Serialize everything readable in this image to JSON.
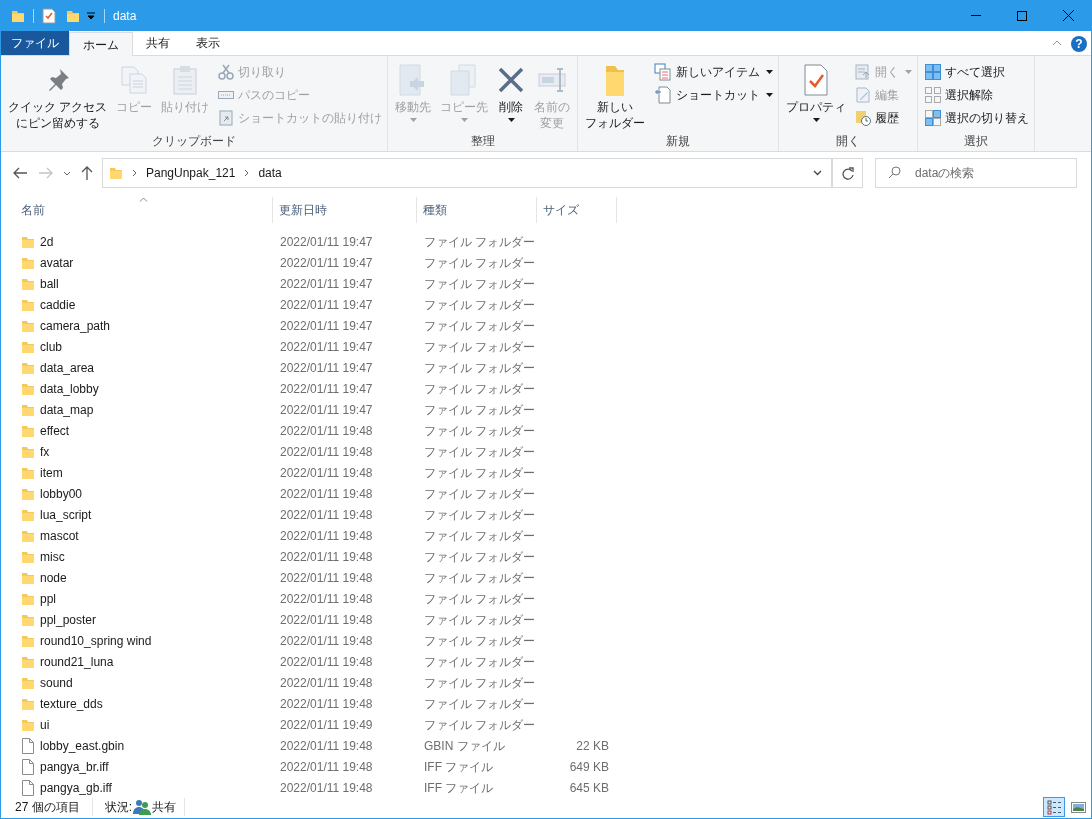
{
  "window": {
    "title": "data"
  },
  "ribbon": {
    "tabs": [
      {
        "label": "ファイル",
        "kind": "file",
        "selected": false
      },
      {
        "label": "ホーム",
        "kind": "tab",
        "selected": true
      },
      {
        "label": "共有",
        "kind": "tab",
        "selected": false
      },
      {
        "label": "表示",
        "kind": "tab",
        "selected": false
      }
    ],
    "groups": [
      {
        "label": "クリップボード",
        "items": [
          {
            "lines": [
              "クイック アクセス",
              "にピン留めする"
            ],
            "kind": "large",
            "disabled": false,
            "dropdown": false
          },
          {
            "label": "コピー",
            "kind": "large",
            "disabled": true,
            "dropdown": false
          },
          {
            "label": "貼り付け",
            "kind": "large",
            "disabled": true,
            "dropdown": false
          },
          {
            "label": "切り取り",
            "kind": "small",
            "disabled": true,
            "dropdown": false
          },
          {
            "label": "パスのコピー",
            "kind": "small",
            "disabled": true,
            "dropdown": false
          },
          {
            "label": "ショートカットの貼り付け",
            "kind": "small",
            "disabled": true,
            "dropdown": false
          }
        ]
      },
      {
        "label": "整理",
        "items": [
          {
            "label": "移動先",
            "kind": "large",
            "disabled": true,
            "dropdown": true
          },
          {
            "label": "コピー先",
            "kind": "large",
            "disabled": true,
            "dropdown": true
          },
          {
            "label": "削除",
            "kind": "large",
            "disabled": false,
            "dropdown": true
          },
          {
            "lines": [
              "名前の",
              "変更"
            ],
            "kind": "large",
            "disabled": true,
            "dropdown": false
          }
        ]
      },
      {
        "label": "新規",
        "items": [
          {
            "lines": [
              "新しい",
              "フォルダー"
            ],
            "kind": "large",
            "disabled": false,
            "dropdown": false
          },
          {
            "label": "新しいアイテム",
            "kind": "small",
            "disabled": false,
            "dropdown": true
          },
          {
            "label": "ショートカット",
            "kind": "small",
            "disabled": false,
            "dropdown": true
          }
        ]
      },
      {
        "label": "開く",
        "items": [
          {
            "label": "プロパティ",
            "kind": "large",
            "disabled": false,
            "dropdown": true
          },
          {
            "label": "開く",
            "kind": "small",
            "disabled": true,
            "dropdown": true
          },
          {
            "label": "編集",
            "kind": "small",
            "disabled": true,
            "dropdown": false
          },
          {
            "label": "履歴",
            "kind": "small",
            "disabled": false,
            "dropdown": false
          }
        ]
      },
      {
        "label": "選択",
        "items": [
          {
            "label": "すべて選択",
            "kind": "small",
            "disabled": false,
            "dropdown": false
          },
          {
            "label": "選択解除",
            "kind": "small",
            "disabled": false,
            "dropdown": false
          },
          {
            "label": "選択の切り替え",
            "kind": "small",
            "disabled": false,
            "dropdown": false
          }
        ]
      }
    ]
  },
  "help_button": {
    "label": "?"
  },
  "address": {
    "path": [
      "PangUnpak_121",
      "data"
    ],
    "search_placeholder": "dataの検索"
  },
  "columns": [
    {
      "label": "名前",
      "sorted": true
    },
    {
      "label": "更新日時",
      "sorted": false
    },
    {
      "label": "種類",
      "sorted": false
    },
    {
      "label": "サイズ",
      "sorted": false
    }
  ],
  "rows": [
    {
      "kind": "folder",
      "name": "2d",
      "modified": "2022/01/11 19:47",
      "type": "ファイル フォルダー"
    },
    {
      "kind": "folder",
      "name": "avatar",
      "modified": "2022/01/11 19:47",
      "type": "ファイル フォルダー"
    },
    {
      "kind": "folder",
      "name": "ball",
      "modified": "2022/01/11 19:47",
      "type": "ファイル フォルダー"
    },
    {
      "kind": "folder",
      "name": "caddie",
      "modified": "2022/01/11 19:47",
      "type": "ファイル フォルダー"
    },
    {
      "kind": "folder",
      "name": "camera_path",
      "modified": "2022/01/11 19:47",
      "type": "ファイル フォルダー"
    },
    {
      "kind": "folder",
      "name": "club",
      "modified": "2022/01/11 19:47",
      "type": "ファイル フォルダー"
    },
    {
      "kind": "folder",
      "name": "data_area",
      "modified": "2022/01/11 19:47",
      "type": "ファイル フォルダー"
    },
    {
      "kind": "folder",
      "name": "data_lobby",
      "modified": "2022/01/11 19:47",
      "type": "ファイル フォルダー"
    },
    {
      "kind": "folder",
      "name": "data_map",
      "modified": "2022/01/11 19:47",
      "type": "ファイル フォルダー"
    },
    {
      "kind": "folder",
      "name": "effect",
      "modified": "2022/01/11 19:48",
      "type": "ファイル フォルダー"
    },
    {
      "kind": "folder",
      "name": "fx",
      "modified": "2022/01/11 19:48",
      "type": "ファイル フォルダー"
    },
    {
      "kind": "folder",
      "name": "item",
      "modified": "2022/01/11 19:48",
      "type": "ファイル フォルダー"
    },
    {
      "kind": "folder",
      "name": "lobby00",
      "modified": "2022/01/11 19:48",
      "type": "ファイル フォルダー"
    },
    {
      "kind": "folder",
      "name": "lua_script",
      "modified": "2022/01/11 19:48",
      "type": "ファイル フォルダー"
    },
    {
      "kind": "folder",
      "name": "mascot",
      "modified": "2022/01/11 19:48",
      "type": "ファイル フォルダー"
    },
    {
      "kind": "folder",
      "name": "misc",
      "modified": "2022/01/11 19:48",
      "type": "ファイル フォルダー"
    },
    {
      "kind": "folder",
      "name": "node",
      "modified": "2022/01/11 19:48",
      "type": "ファイル フォルダー"
    },
    {
      "kind": "folder",
      "name": "ppl",
      "modified": "2022/01/11 19:48",
      "type": "ファイル フォルダー"
    },
    {
      "kind": "folder",
      "name": "ppl_poster",
      "modified": "2022/01/11 19:48",
      "type": "ファイル フォルダー"
    },
    {
      "kind": "folder",
      "name": "round10_spring wind",
      "modified": "2022/01/11 19:48",
      "type": "ファイル フォルダー"
    },
    {
      "kind": "folder",
      "name": "round21_luna",
      "modified": "2022/01/11 19:48",
      "type": "ファイル フォルダー"
    },
    {
      "kind": "folder",
      "name": "sound",
      "modified": "2022/01/11 19:48",
      "type": "ファイル フォルダー"
    },
    {
      "kind": "folder",
      "name": "texture_dds",
      "modified": "2022/01/11 19:48",
      "type": "ファイル フォルダー"
    },
    {
      "kind": "folder",
      "name": "ui",
      "modified": "2022/01/11 19:49",
      "type": "ファイル フォルダー"
    },
    {
      "kind": "file",
      "name": "lobby_east.gbin",
      "modified": "2022/01/11 19:48",
      "type": "GBIN ファイル",
      "size": "22 KB"
    },
    {
      "kind": "file",
      "name": "pangya_br.iff",
      "modified": "2022/01/11 19:48",
      "type": "IFF ファイル",
      "size": "649 KB"
    },
    {
      "kind": "file",
      "name": "pangya_gb.iff",
      "modified": "2022/01/11 19:48",
      "type": "IFF ファイル",
      "size": "645 KB"
    }
  ],
  "status_bar": {
    "item_count": "27 個の項目",
    "state_label": "状況:",
    "state_value": "共有"
  },
  "views": [
    {
      "selected": true
    },
    {
      "selected": false
    }
  ]
}
